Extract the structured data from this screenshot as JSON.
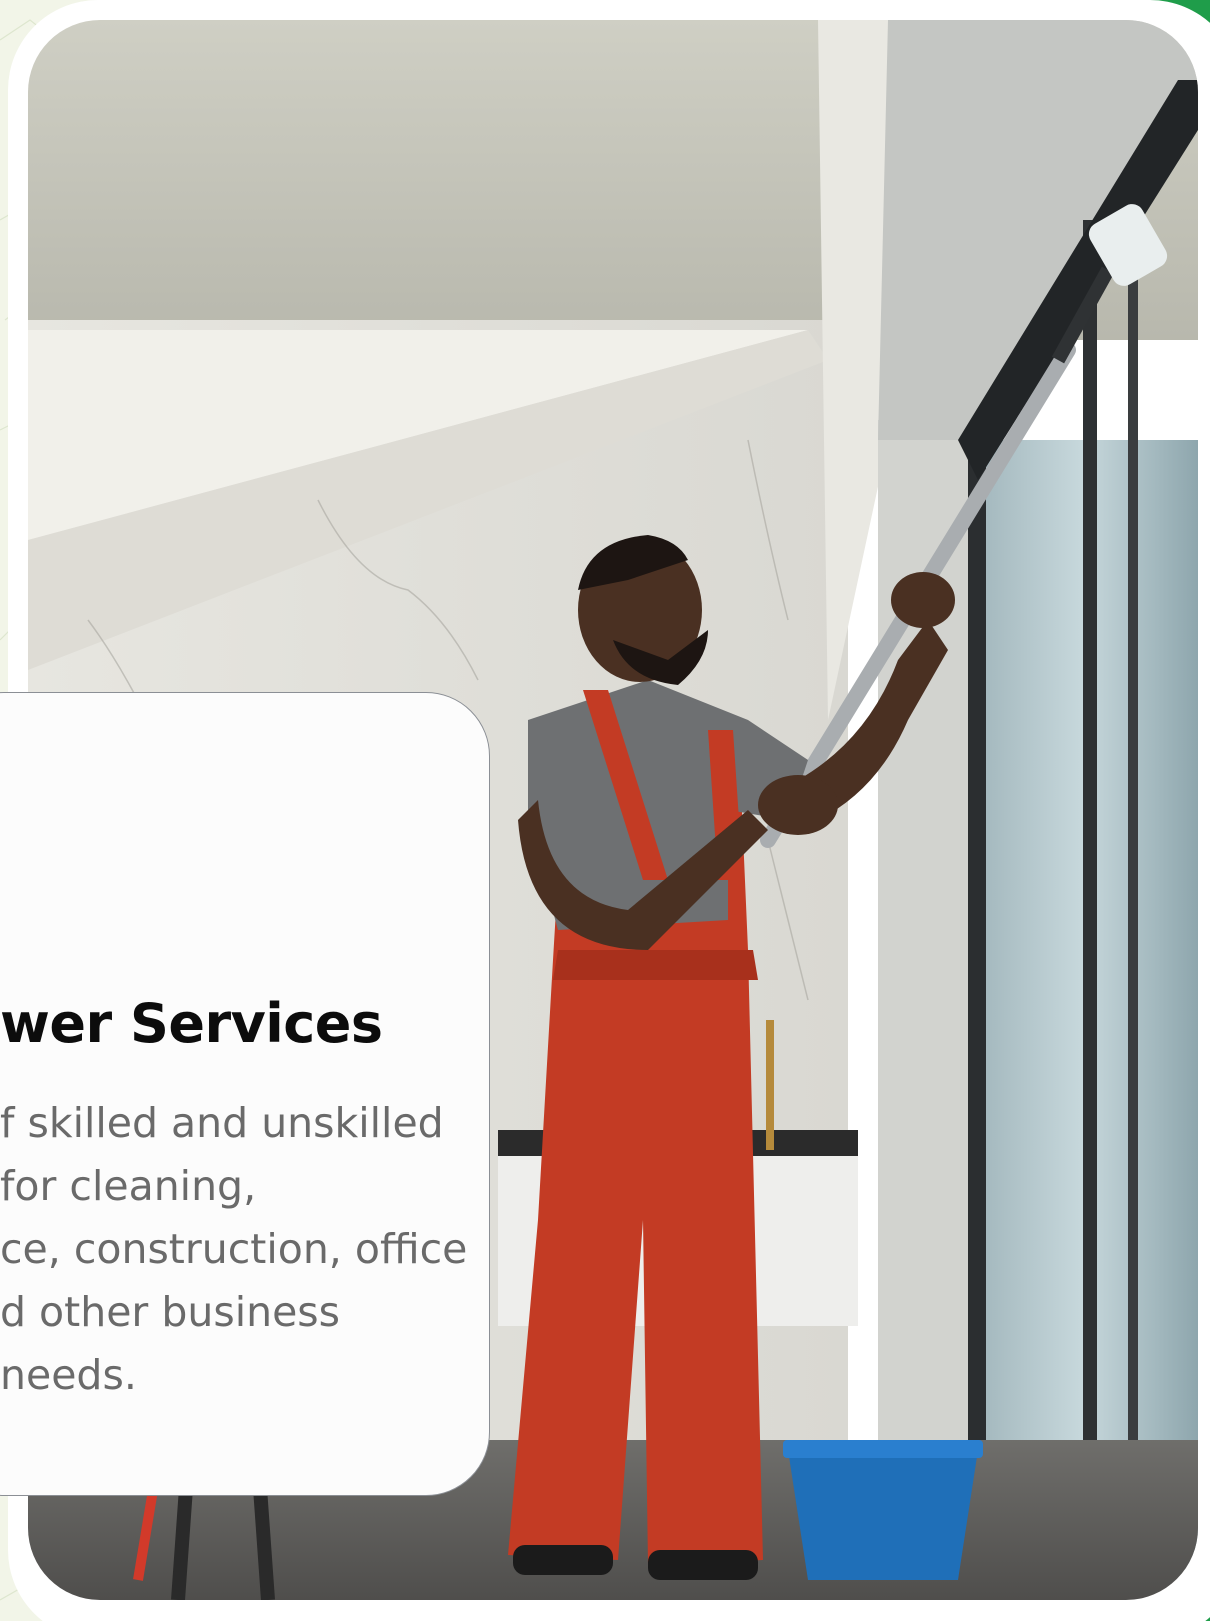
{
  "card": {
    "title": "wer Services",
    "description_lines": [
      "f skilled and unskilled",
      "for cleaning,",
      "ce, construction, office",
      "d other business",
      " needs."
    ]
  },
  "colors": {
    "accent_green": "#1f9d4a",
    "card_bg": "#fcfcfc",
    "title_color": "#0c0c0c",
    "text_color": "#6a6a6a"
  },
  "photo": {
    "subject-icon": "worker-cleaning-window"
  }
}
